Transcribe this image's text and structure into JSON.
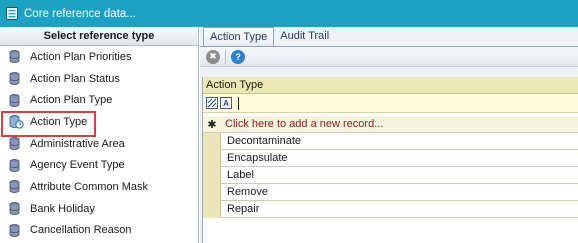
{
  "window": {
    "title": "Core reference data..."
  },
  "sidebar": {
    "header": "Select reference type",
    "items": [
      {
        "label": "Action Plan Priorities",
        "icon": "database-icon"
      },
      {
        "label": "Action Plan Status",
        "icon": "database-icon"
      },
      {
        "label": "Action Plan Type",
        "icon": "database-icon"
      },
      {
        "label": "Action Type",
        "icon": "database-refresh-icon",
        "selected": true
      },
      {
        "label": "Administrative Area",
        "icon": "database-icon"
      },
      {
        "label": "Agency Event Type",
        "icon": "database-icon"
      },
      {
        "label": "Attribute Common Mask",
        "icon": "database-icon"
      },
      {
        "label": "Bank Holiday",
        "icon": "database-icon"
      },
      {
        "label": "Cancellation Reason",
        "icon": "database-icon"
      }
    ]
  },
  "tabs": [
    {
      "label": "Action Type",
      "active": true
    },
    {
      "label": "Audit Trail",
      "active": false
    }
  ],
  "grid": {
    "column_header": "Action Type",
    "filter_icons": [
      "A"
    ],
    "filter_value": "",
    "add_record_text": "Click here to add a new record...",
    "add_record_symbol": "✱",
    "rows": [
      "Decontaminate",
      "Encapsulate",
      "Label",
      "Remove",
      "Repair"
    ]
  },
  "toolbar": {
    "clear_symbol": "✖",
    "help_symbol": "?"
  },
  "colors": {
    "titlebar": "#1ba1c4",
    "selection_outline": "#e03c3c",
    "grid_header": "#ebe9b3",
    "add_record_text": "#8b1c1c"
  }
}
